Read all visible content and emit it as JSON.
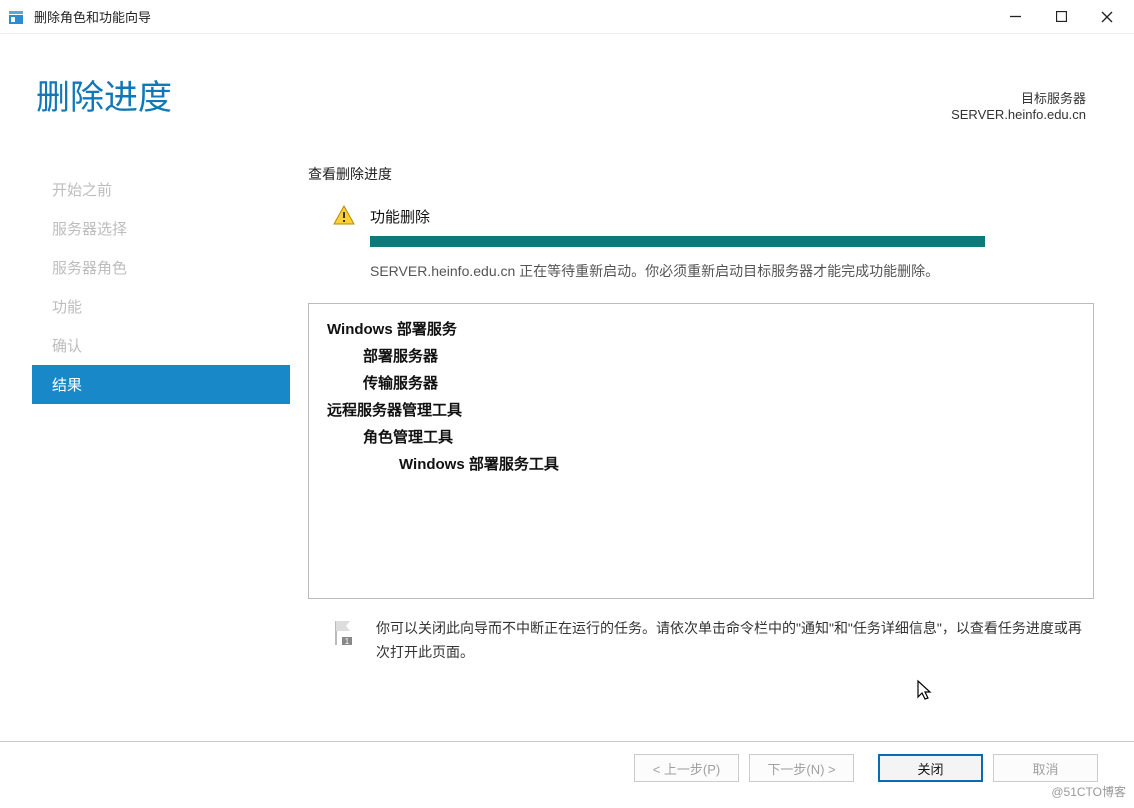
{
  "window": {
    "title": "删除角色和功能向导"
  },
  "header": {
    "page_title": "删除进度",
    "target_label": "目标服务器",
    "target_server": "SERVER.heinfo.edu.cn"
  },
  "sidebar": {
    "steps": [
      {
        "label": "开始之前",
        "active": false
      },
      {
        "label": "服务器选择",
        "active": false
      },
      {
        "label": "服务器角色",
        "active": false
      },
      {
        "label": "功能",
        "active": false
      },
      {
        "label": "确认",
        "active": false
      },
      {
        "label": "结果",
        "active": true
      }
    ]
  },
  "main": {
    "section_label": "查看删除进度",
    "status_title": "功能删除",
    "status_message": "SERVER.heinfo.edu.cn 正在等待重新启动。你必须重新启动目标服务器才能完成功能删除。",
    "details": [
      {
        "text": "Windows 部署服务",
        "level": 0
      },
      {
        "text": "部署服务器",
        "level": 1
      },
      {
        "text": "传输服务器",
        "level": 1
      },
      {
        "text": "远程服务器管理工具",
        "level": 0
      },
      {
        "text": "角色管理工具",
        "level": 1
      },
      {
        "text": "Windows 部署服务工具",
        "level": 2
      }
    ],
    "note": "你可以关闭此向导而不中断正在运行的任务。请依次单击命令栏中的\"通知\"和\"任务详细信息\"，以查看任务进度或再次打开此页面。"
  },
  "buttons": {
    "prev": "< 上一步(P)",
    "next": "下一步(N) >",
    "close": "关闭",
    "cancel": "取消"
  },
  "watermark": "@51CTO博客"
}
